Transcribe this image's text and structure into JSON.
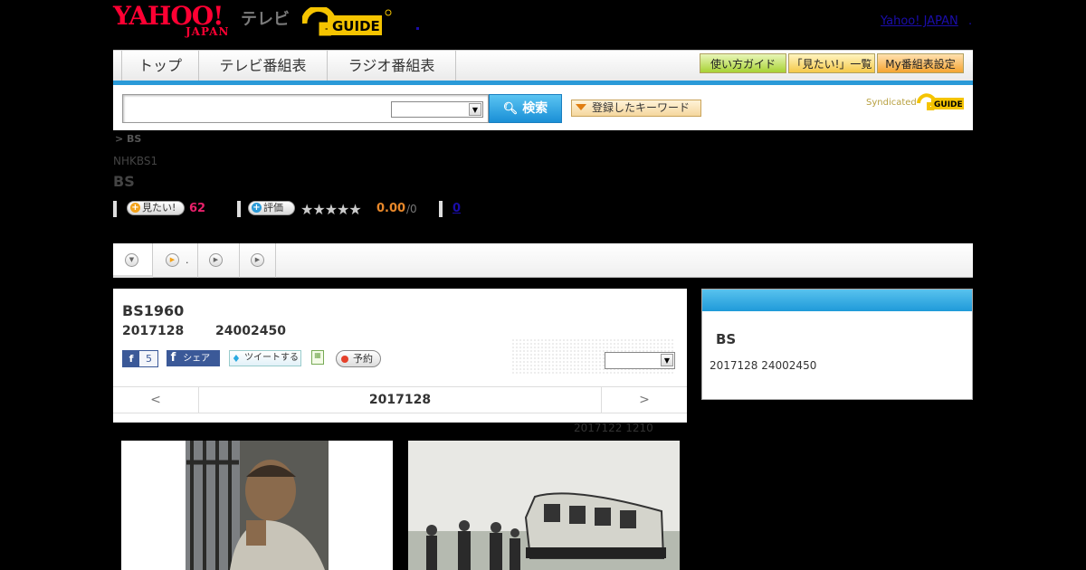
{
  "header": {
    "logo_yahoo": "YAHOO!",
    "logo_japan": "JAPAN",
    "logo_tv": "テレビ",
    "logo_gguide": "G GUIDE",
    "yahoo_japan_link": "Yahoo! JAPAN",
    "yahoo_japan_sep": "."
  },
  "nav": {
    "tabs": [
      "トップ",
      "テレビ番組表",
      "ラジオ番組表"
    ],
    "guide_buttons": [
      "使い方ガイド",
      "「見たい!」一覧",
      "My番組表設定"
    ]
  },
  "search": {
    "input_value": "",
    "select_value": "",
    "button_label": "検索",
    "keyword_button": "登録したキーワード",
    "syndicated": "Syndicated"
  },
  "program": {
    "breadcrumb": "> BS",
    "channel": "NHKBS1",
    "title": "BS",
    "want_label": "見たい!",
    "want_count": "62",
    "rate_label": "評価",
    "stars": "★★★★★",
    "rating": "0.00",
    "rating_total": "/0",
    "reviews": "0"
  },
  "tabstrip": {
    "tab2_dot": "."
  },
  "main": {
    "title": "BS1960",
    "date": "2017128",
    "time": "24002450",
    "fb_count": "5",
    "share_label": "シェア",
    "tweet_label": "ツイートする",
    "reserve_label": "予約",
    "date_prev": "<",
    "date_current": "2017128",
    "date_next": ">",
    "update_note": "2017122  1210"
  },
  "side": {
    "title": "BS",
    "date": "2017128  24002450"
  },
  "colors": {
    "accent_blue": "#2a9ad8",
    "yahoo_red": "#ff0033",
    "want_pink": "#e8206a",
    "rating_orange": "#e8882a"
  }
}
